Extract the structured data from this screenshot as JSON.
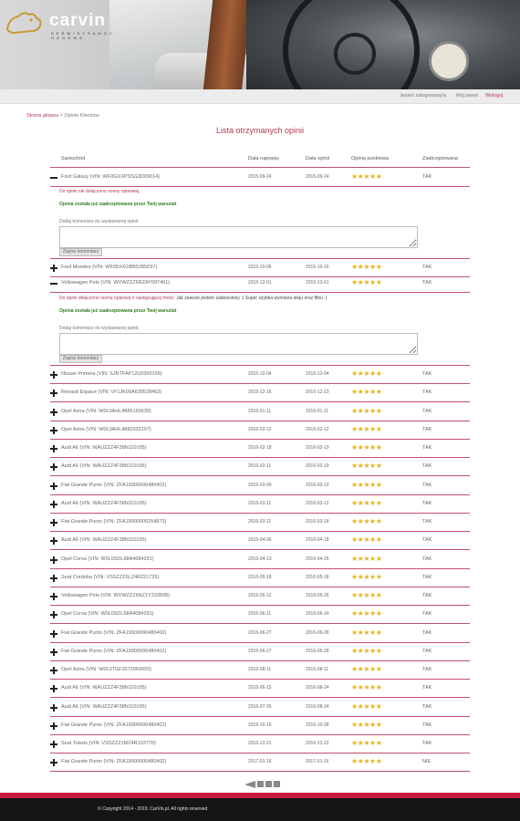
{
  "logo": {
    "brand_main": "car",
    "brand_accent": "vin",
    "tagline": "S E R W I S Y  S A M O C H O D O W E"
  },
  "topnav": {
    "logged_in": "Jesteś zalogowany/a",
    "my_panel": "Mój panel",
    "logout": "Wyloguj"
  },
  "breadcrumb": {
    "home": "Strona główna",
    "sep": " > ",
    "current": "Opinie Klientów"
  },
  "page_title": "Lista otrzymanych opinii",
  "table": {
    "headers": {
      "car": "Samochód",
      "repair_date": "Data naprawy",
      "opinion_date": "Data opinii",
      "rating": "Opinia punktowa",
      "accepted": "Zaakceptowana"
    },
    "stars": "★★★★★",
    "rows": [
      {
        "car": "Ford Galaxy (VIN: WF0GXXPSSG3D09014)",
        "repair": "2015-09-24",
        "opinion": "2015-09-24",
        "accepted": "TAK",
        "open": true
      },
      {
        "car": "Ford Mondeo (VIN: WF05XXGBB5285037)",
        "repair": "2015-10-06",
        "opinion": "2015-10-16",
        "accepted": "TAK",
        "open": false
      },
      {
        "car": "Volkswagen Polo (VIN: WVWZZZ6RZAY097401)",
        "repair": "2015-12-01",
        "opinion": "2015-12-01",
        "accepted": "TAK",
        "open": true
      },
      {
        "car": "Nissan Primera (VIN: SJNTFAP12U0260159)",
        "repair": "2015-12-04",
        "opinion": "2015-12-04",
        "accepted": "TAK",
        "open": false
      },
      {
        "car": "Renault Espace (VIN: VF1JK09A639528463)",
        "repair": "2015-12-16",
        "opinion": "2015-12-23",
        "accepted": "TAK",
        "open": false
      },
      {
        "car": "Opel Astra (VIN: W0L0AHL4885160639)",
        "repair": "2016-01-11",
        "opinion": "2016-01-11",
        "accepted": "TAK",
        "open": false
      },
      {
        "car": "Opel Astra (VIN: W0L0AHL4882033197)",
        "repair": "2016-02-12",
        "opinion": "2016-02-12",
        "accepted": "TAK",
        "open": false
      },
      {
        "car": "Audi A6 (VIN: WAUZZZ4F38N110195)",
        "repair": "2016-02-18",
        "opinion": "2016-02-19",
        "accepted": "TAK",
        "open": false
      },
      {
        "car": "Audi A6 (VIN: WAUZZZ4F38N110195)",
        "repair": "2016-02-11",
        "opinion": "2016-02-19",
        "accepted": "TAK",
        "open": false
      },
      {
        "car": "Fiat Grande Punto (VIN: ZFA19900000480402)",
        "repair": "2016-03-09",
        "opinion": "2016-03-10",
        "accepted": "TAK",
        "open": false
      },
      {
        "car": "Audi A6 (VIN: WAUZZZ4F38N110195)",
        "repair": "2016-03-11",
        "opinion": "2016-03-12",
        "accepted": "TAK",
        "open": false
      },
      {
        "car": "Fiat Grande Punto (VIN: ZFA19900000254873)",
        "repair": "2016-03-11",
        "opinion": "2016-03-18",
        "accepted": "TAK",
        "open": false
      },
      {
        "car": "Audi A6 (VIN: WAUZZZ4F38N110195)",
        "repair": "2016-04-06",
        "opinion": "2016-04-18",
        "accepted": "TAK",
        "open": false
      },
      {
        "car": "Opel Corsa (VIN: W0L0SDL68A4084291)",
        "repair": "2016-04-13",
        "opinion": "2016-04-25",
        "accepted": "TAK",
        "open": false
      },
      {
        "car": "Seat Cordoba (VIN: VSSZZZ6LZ4R221726)",
        "repair": "2016-05-18",
        "opinion": "2016-05-18",
        "accepted": "TAK",
        "open": false
      },
      {
        "car": "Volkswagen Polo (VIN: WVWZZZ6NZ1Y233508)",
        "repair": "2016-05-12",
        "opinion": "2016-05-26",
        "accepted": "TAK",
        "open": false
      },
      {
        "car": "Opel Corsa (VIN: W0L0SDL68A4084291)",
        "repair": "2016-06-11",
        "opinion": "2016-06-14",
        "accepted": "TAK",
        "open": false
      },
      {
        "car": "Fiat Grande Punto (VIN: ZFA19900000480402)",
        "repair": "2016-06-27",
        "opinion": "2016-06-28",
        "accepted": "TAK",
        "open": false
      },
      {
        "car": "Fiat Grande Punto (VIN: ZFA19900000480402)",
        "repair": "2016-06-27",
        "opinion": "2016-06-28",
        "accepted": "TAK",
        "open": false
      },
      {
        "car": "Opel Astra (VIN: W0L0TGF3572069993)",
        "repair": "2016-08-11",
        "opinion": "2016-08-11",
        "accepted": "TAK",
        "open": false
      },
      {
        "car": "Audi A6 (VIN: WAUZZZ4F38N110195)",
        "repair": "2016-06-15",
        "opinion": "2016-08-24",
        "accepted": "TAK",
        "open": false
      },
      {
        "car": "Audi A6 (VIN: WAUZZZ4F38N110195)",
        "repair": "2016-07-26",
        "opinion": "2016-08-24",
        "accepted": "TAK",
        "open": false
      },
      {
        "car": "Fiat Grande Punto (VIN: ZFA19900000480402)",
        "repair": "2016-10-18",
        "opinion": "2016-10-28",
        "accepted": "TAK",
        "open": false
      },
      {
        "car": "Seat Toledo (VIN: VSSZZZ1MZ4R103770)",
        "repair": "2016-12-21",
        "opinion": "2016-12-22",
        "accepted": "TAK",
        "open": false
      },
      {
        "car": "Fiat Grande Punto (VIN: ZFA19900000480402)",
        "repair": "2017-01-16",
        "opinion": "2017-01-16",
        "accepted": "NIE",
        "open": false
      }
    ]
  },
  "details": {
    "first": {
      "note": "Do opinii nie dołączono oceny opisowej.",
      "accepted": "Opinia została już zaakceptowana przez Twój warsztat",
      "comment_label": "Dodaj komentarz do wystawionej opinii:",
      "button": "Zapisz komentarz"
    },
    "second": {
      "note": "Do opinii dołączono ocenę opisową o następującej treści:",
      "quote": " Jak zawsze jestem zadowolony :) Super szybka wymiana oleju oraz filtru :)",
      "accepted": "Opinia została już zaakceptowana przez Twój warsztat",
      "comment_label": "Dodaj komentarz do wystawionej opinii:",
      "button": "Zapisz komentarz"
    }
  },
  "footer": {
    "copyright": "© Copyright 2014 - 2019. CarVin.pl. All rights reserved."
  },
  "colors": {
    "accent": "#b03a54",
    "pink_bar": "#c8193f",
    "star": "#e6b422",
    "accepted_text": "#2e7d1f"
  }
}
